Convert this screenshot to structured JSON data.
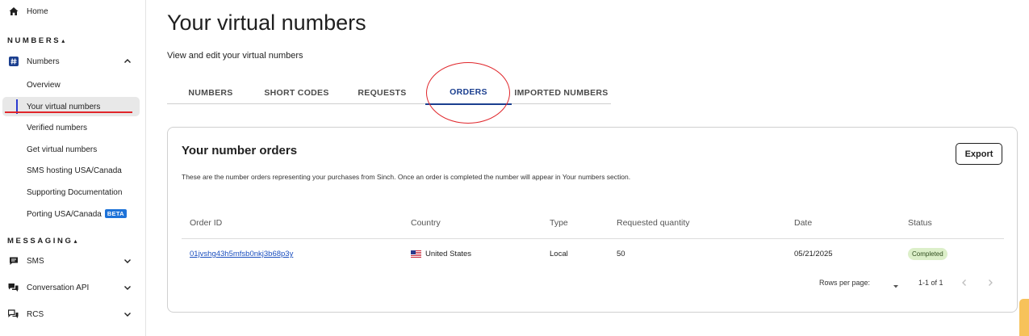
{
  "sidebar": {
    "home_label": "Home",
    "numbers_section": "NUMBERS",
    "numbers_group_label": "Numbers",
    "numbers_items": [
      {
        "label": "Overview"
      },
      {
        "label": "Your virtual numbers"
      },
      {
        "label": "Verified numbers"
      },
      {
        "label": "Get virtual numbers"
      },
      {
        "label": "SMS hosting USA/Canada"
      },
      {
        "label": "Supporting Documentation"
      },
      {
        "label": "Porting USA/Canada"
      }
    ],
    "beta_badge": "BETA",
    "messaging_section": "MESSAGING",
    "messaging_items": [
      {
        "label": "SMS"
      },
      {
        "label": "Conversation API"
      },
      {
        "label": "RCS"
      }
    ]
  },
  "page": {
    "title": "Your virtual numbers",
    "subtitle": "View and edit your virtual numbers"
  },
  "tabs": [
    {
      "label": "NUMBERS"
    },
    {
      "label": "SHORT CODES"
    },
    {
      "label": "REQUESTS"
    },
    {
      "label": "ORDERS"
    },
    {
      "label": "IMPORTED NUMBERS"
    }
  ],
  "active_tab": "ORDERS",
  "card": {
    "title": "Your number orders",
    "description": "These are the number orders representing your purchases from Sinch. Once an order is completed the number will appear in Your numbers section.",
    "export_label": "Export"
  },
  "table": {
    "columns": [
      "Order ID",
      "Country",
      "Type",
      "Requested quantity",
      "Date",
      "Status"
    ],
    "rows": [
      {
        "order_id": "01jvshg43h5mfsb0nkj3b68p3y",
        "country": "United States",
        "type": "Local",
        "quantity": "50",
        "date": "05/21/2025",
        "status": "Completed"
      }
    ]
  },
  "pagination": {
    "rows_per_page_label": "Rows per page:",
    "range": "1-1 of 1"
  },
  "colors": {
    "accent": "#1b3f8f",
    "link": "#1b4fbf",
    "annotation_red": "#e0262b",
    "status_bg": "#dcefc9",
    "beta_bg": "#1d72d8",
    "feedback_tab": "#f7c25a"
  }
}
